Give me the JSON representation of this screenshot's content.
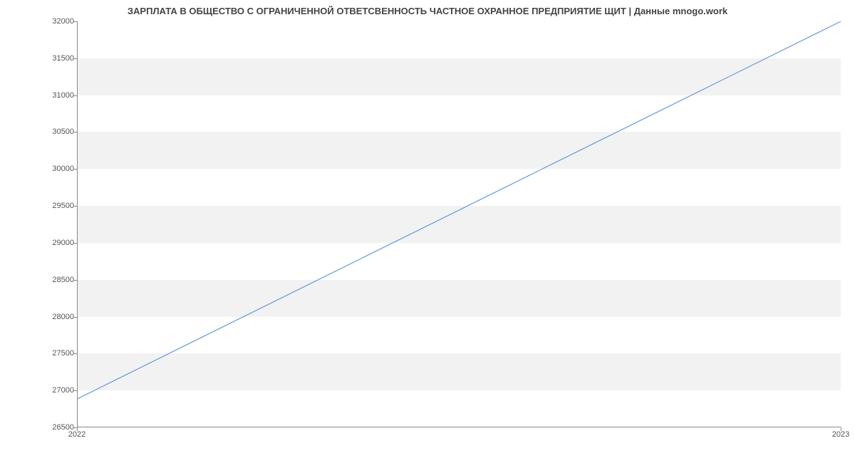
{
  "chart_data": {
    "type": "line",
    "title": "ЗАРПЛАТА В ОБЩЕСТВО С ОГРАНИЧЕННОЙ ОТВЕТСВЕННОСТЬ ЧАСТНОЕ ОХРАННОЕ ПРЕДПРИЯТИЕ ЩИТ | Данные mnogo.work",
    "xlabel": "",
    "ylabel": "",
    "x": [
      2022,
      2023
    ],
    "values": [
      26880,
      32000
    ],
    "x_ticks": [
      2022,
      2023
    ],
    "y_ticks": [
      26500,
      27000,
      27500,
      28000,
      28500,
      29000,
      29500,
      30000,
      30500,
      31000,
      31500,
      32000
    ],
    "ylim": [
      26500,
      32000
    ],
    "xlim": [
      2022,
      2023
    ],
    "line_color": "#6699dd"
  }
}
